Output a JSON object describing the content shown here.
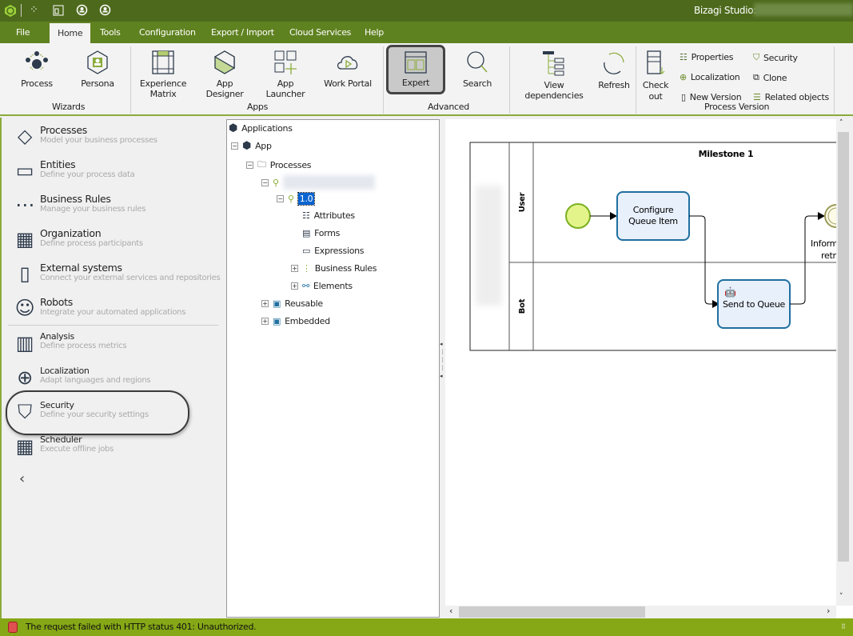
{
  "title": {
    "app_title": "Bizagi Studio:"
  },
  "menu": [
    "File",
    "Home",
    "Tools",
    "Configuration",
    "Export / Import",
    "Cloud Services",
    "Help"
  ],
  "ribbon": {
    "wizards": {
      "label": "Wizards",
      "process": "Process",
      "persona": "Persona"
    },
    "apps": {
      "label": "Apps",
      "experience_matrix": "Experience Matrix",
      "app_designer": "App Designer",
      "app_launcher": "App Launcher",
      "work_portal": "Work Portal"
    },
    "advanced": {
      "label": "Advanced",
      "expert": "Expert",
      "search": "Search"
    },
    "view_dependencies": "View dependencies",
    "refresh": "Refresh",
    "process_version": {
      "label": "Process Version",
      "check_out": "Check out",
      "properties": "Properties",
      "localization": "Localization",
      "new_version": "New Version",
      "security": "Security",
      "clone": "Clone",
      "related_objects": "Related objects"
    }
  },
  "nav": [
    {
      "title": "Processes",
      "subtitle": "Model your business processes"
    },
    {
      "title": "Entities",
      "subtitle": "Define your process data"
    },
    {
      "title": "Business Rules",
      "subtitle": "Manage your business rules"
    },
    {
      "title": "Organization",
      "subtitle": "Define process participants"
    },
    {
      "title": "External systems",
      "subtitle": "Connect your external services and repositories"
    },
    {
      "title": "Robots",
      "subtitle": "Integrate your automated applications"
    },
    {
      "title": "Analysis",
      "subtitle": "Define process metrics"
    },
    {
      "title": "Localization",
      "subtitle": "Adapt languages and regions"
    },
    {
      "title": "Security",
      "subtitle": "Define your security settings"
    },
    {
      "title": "Scheduler",
      "subtitle": "Execute offline jobs"
    }
  ],
  "tree": {
    "applications": "Applications",
    "app": "App",
    "processes": "Processes",
    "version": "1.0",
    "attributes": "Attributes",
    "forms": "Forms",
    "expressions": "Expressions",
    "business_rules": "Business Rules",
    "elements": "Elements",
    "reusable": "Reusable",
    "embedded": "Embedded"
  },
  "diagram": {
    "milestone": "Milestone 1",
    "lanes": [
      "User",
      "Bot"
    ],
    "task1": "Configure Queue Item",
    "task2": "Send to Queue",
    "event_label_line1": "Inform",
    "event_label_line2": "retri"
  },
  "status": {
    "message": "The request failed with HTTP status 401: Unauthorized."
  },
  "colors": {
    "title_bar": "#4d6a1c",
    "menu_bar": "#5f8220",
    "status_bar": "#86a816",
    "accent": "#8aab3a",
    "task_border": "#1f6fa0",
    "task_fill": "#e8f0fc",
    "start_event": "#e2f48a"
  }
}
